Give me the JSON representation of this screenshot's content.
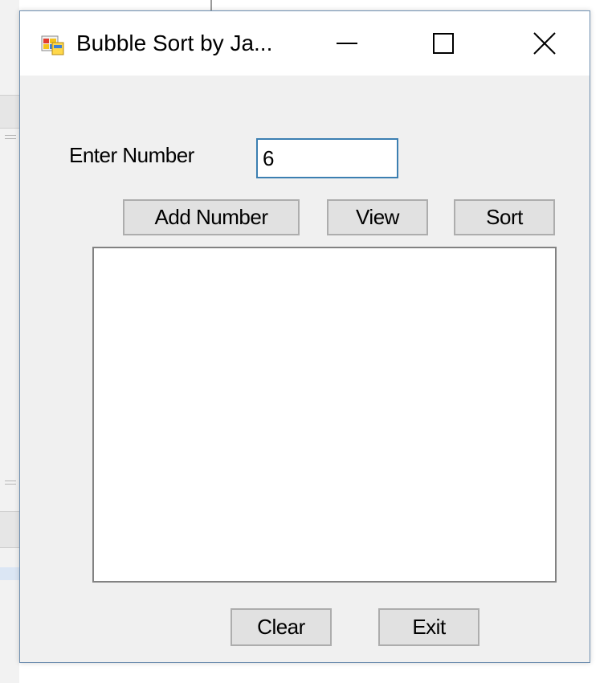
{
  "window": {
    "title": "Bubble Sort by Ja..."
  },
  "form": {
    "enter_label": "Enter Number",
    "number_value": "6"
  },
  "buttons": {
    "add_number": "Add Number",
    "view": "View",
    "sort": "Sort",
    "clear": "Clear",
    "exit": "Exit"
  },
  "listbox": {
    "items": []
  },
  "icons": {
    "app": "app-form-icon",
    "minimize": "minimize-icon",
    "maximize": "maximize-icon",
    "close": "close-icon"
  },
  "colors": {
    "input_focus_border": "#3c7fb1",
    "button_face": "#e1e1e1",
    "window_bg": "#f0f0f0"
  }
}
